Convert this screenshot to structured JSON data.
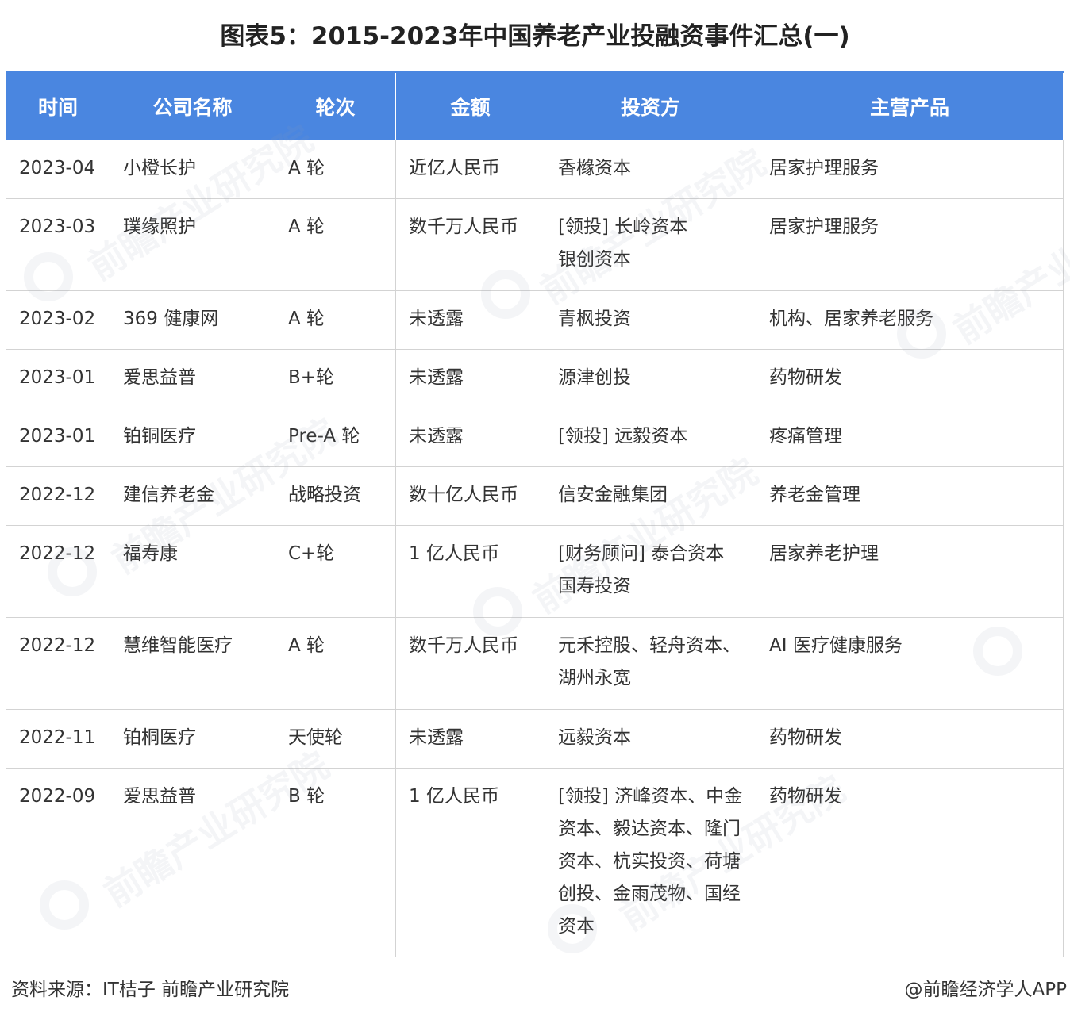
{
  "title": "图表5：2015-2023年中国养老产业投融资事件汇总(一)",
  "table": {
    "headers": [
      "时间",
      "公司名称",
      "轮次",
      "金额",
      "投资方",
      "主营产品"
    ],
    "rows": [
      {
        "date": "2023-04",
        "company": "小橙长护",
        "round": "A 轮",
        "amount": "近亿人民币",
        "investors": [
          "香橼资本"
        ],
        "product": "居家护理服务"
      },
      {
        "date": "2023-03",
        "company": "璞缘照护",
        "round": "A 轮",
        "amount": "数千万人民币",
        "investors": [
          "[领投] 长岭资本",
          "银创资本"
        ],
        "product": "居家护理服务"
      },
      {
        "date": "2023-02",
        "company": "369 健康网",
        "round": "A 轮",
        "amount": "未透露",
        "investors": [
          "青枫投资"
        ],
        "product": "机构、居家养老服务"
      },
      {
        "date": "2023-01",
        "company": "爱思益普",
        "round": "B+轮",
        "amount": "未透露",
        "investors": [
          "源津创投"
        ],
        "product": "药物研发"
      },
      {
        "date": "2023-01",
        "company": "铂铜医疗",
        "round": "Pre-A 轮",
        "amount": "未透露",
        "investors": [
          "[领投] 远毅资本"
        ],
        "product": "疼痛管理"
      },
      {
        "date": "2022-12",
        "company": "建信养老金",
        "round": "战略投资",
        "amount": "数十亿人民币",
        "investors": [
          "信安金融集团"
        ],
        "product": "养老金管理"
      },
      {
        "date": "2022-12",
        "company": "福寿康",
        "round": "C+轮",
        "amount": "1 亿人民币",
        "investors": [
          "[财务顾问] 泰合资本",
          "国寿投资"
        ],
        "product": "居家养老护理"
      },
      {
        "date": "2022-12",
        "company": "慧维智能医疗",
        "round": "A 轮",
        "amount": "数千万人民币",
        "investors": [
          "元禾控股、轻舟资本、",
          "湖州永宽"
        ],
        "product": "AI 医疗健康服务"
      },
      {
        "date": "2022-11",
        "company": "铂桐医疗",
        "round": "天使轮",
        "amount": "未透露",
        "investors": [
          "远毅资本"
        ],
        "product": "药物研发"
      },
      {
        "date": "2022-09",
        "company": "爱思益普",
        "round": "B 轮",
        "amount": "1 亿人民币",
        "investors": [
          "[领投] 济峰资本、中金",
          "资本、毅达资本、隆门",
          "资本、杭实投资、荷塘",
          "创投、金雨茂物、国经",
          "资本"
        ],
        "product": "药物研发"
      }
    ]
  },
  "footer": {
    "source": "资料来源：IT桔子 前瞻产业研究院",
    "credit": "@前瞻经济学人APP"
  },
  "watermark": {
    "text": "前瞻产业研究院"
  },
  "colors": {
    "header_bg": "#4a86e0",
    "header_text": "#ffffff",
    "border": "#d3d3d3"
  }
}
